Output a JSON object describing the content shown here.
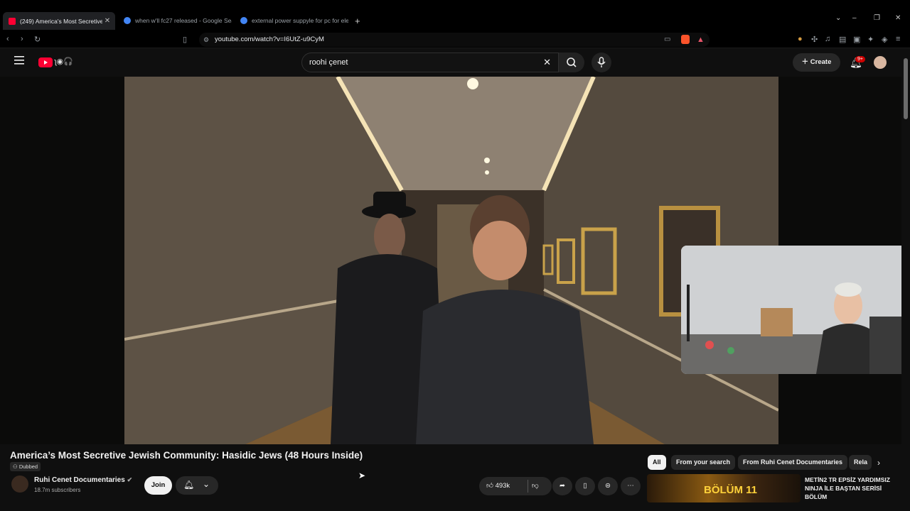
{
  "browser": {
    "tabs": [
      {
        "title": "(249) America's Most Secretive",
        "active": true,
        "icon": "youtube-icon"
      },
      {
        "title": "when w'll fc27 released - Google Sea",
        "active": false,
        "icon": "google-icon"
      },
      {
        "title": "external power suppyle for pc for ele",
        "active": false,
        "icon": "google-icon"
      }
    ],
    "url": "youtube.com/watch?v=I6UtZ-u9CyM"
  },
  "youtube": {
    "search_value": "roohi çenet",
    "create_label": "Create",
    "notification_count": "9+"
  },
  "video": {
    "title": "America’s Most Secretive Jewish Community: Hasidic Jews (48 Hours Inside)",
    "dubbed_label": "Dubbed",
    "channel_name": "Ruhi Cenet Documentaries",
    "subscribers": "18.7m subscribers",
    "join_label": "Join",
    "like_count": "493k"
  },
  "chips": [
    {
      "label": "All",
      "selected": true
    },
    {
      "label": "From your search",
      "selected": false
    },
    {
      "label": "From Ruhi Cenet Documentaries",
      "selected": false
    },
    {
      "label": "Rela",
      "selected": false
    }
  ],
  "recommendation": {
    "title": "METİN2 TR EPSİZ YARDIMSIZ NINJA İLE BAŞTAN SERİSİ BÖLÜM",
    "thumb_text": "BÖLÜM 11"
  },
  "colors": {
    "youtube_red": "#ff0033",
    "badge_red": "#cc0000",
    "background": "#0f0f0f"
  }
}
